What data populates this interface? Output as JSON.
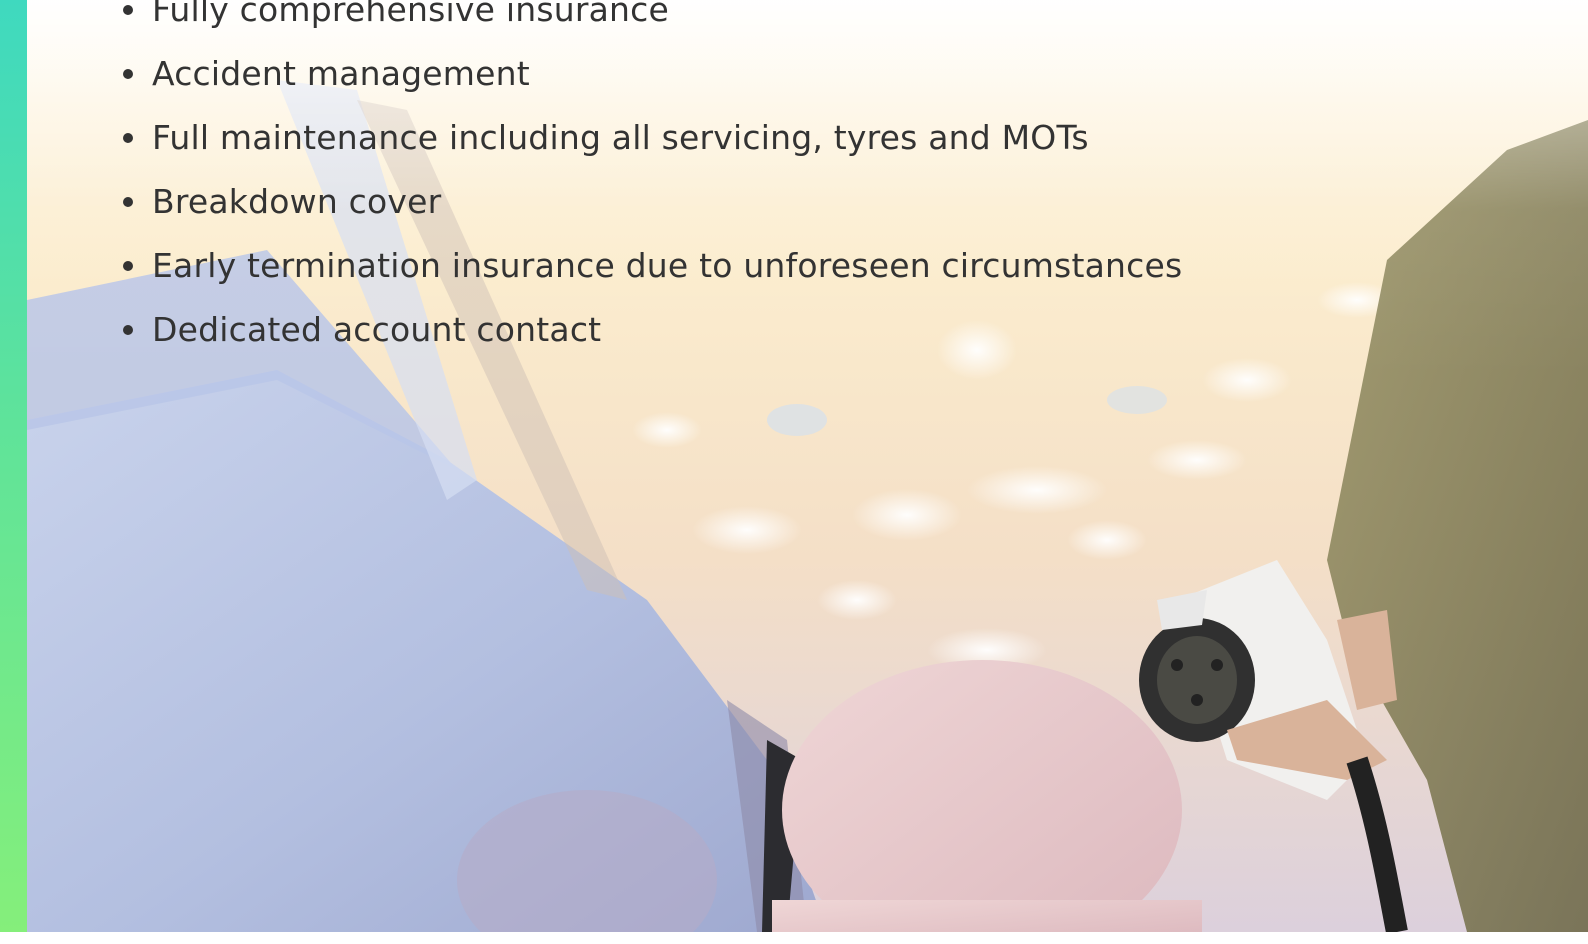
{
  "slide": {
    "benefits": [
      "Fully comprehensive insurance",
      "Accident management",
      "Full maintenance including all servicing, tyres and MOTs",
      "Breakdown cover",
      "Early termination insurance due to unforeseen circumstances",
      "Dedicated account contact"
    ]
  },
  "colors": {
    "accent_top": "#3fd9bf",
    "accent_bottom": "#86ef7a",
    "text": "#333333"
  },
  "background_image": "ev-charging-photo"
}
